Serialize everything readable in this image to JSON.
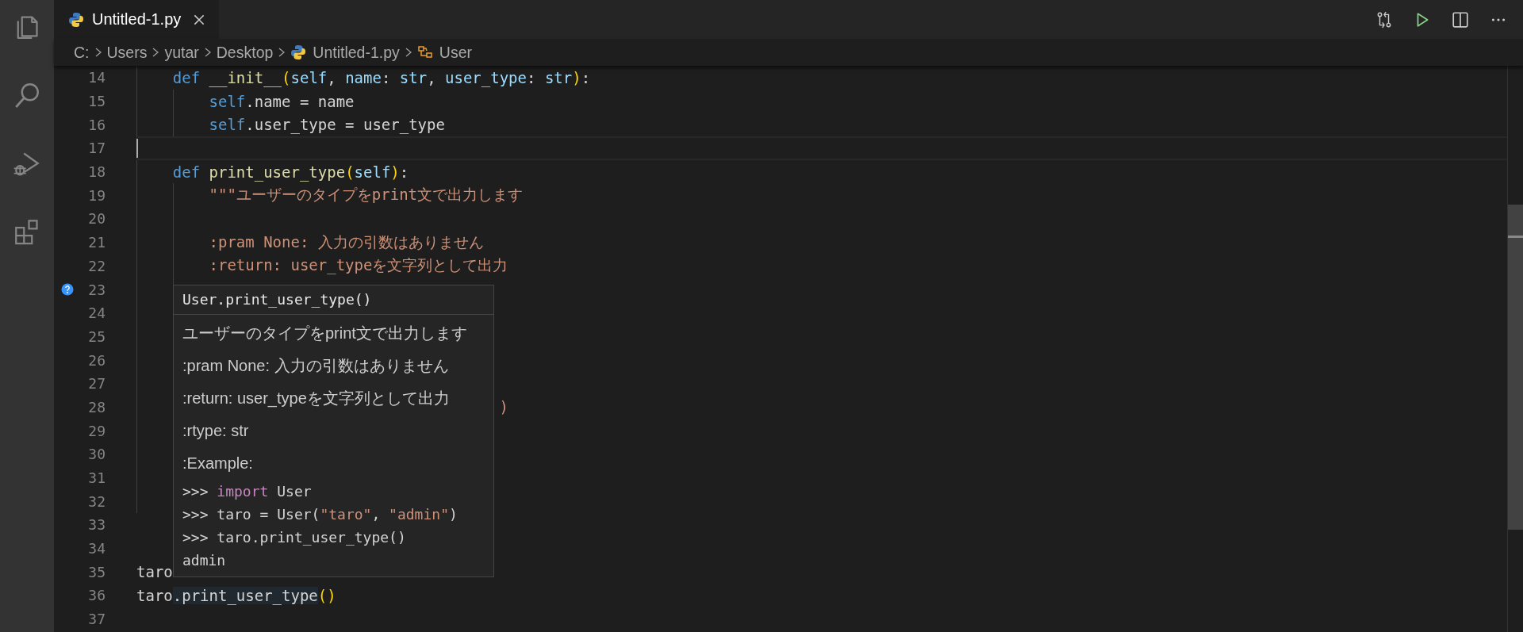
{
  "tab": {
    "label": "Untitled-1.py",
    "selected": true
  },
  "breadcrumbs": [
    {
      "kind": "folder",
      "label": "C:"
    },
    {
      "kind": "folder",
      "label": "Users"
    },
    {
      "kind": "folder",
      "label": "yutar"
    },
    {
      "kind": "folder",
      "label": "Desktop"
    },
    {
      "kind": "file",
      "label": "Untitled-1.py"
    },
    {
      "kind": "class",
      "label": "User"
    }
  ],
  "lines": [
    {
      "number": "14",
      "tokens": [
        {
          "kind": "kw",
          "t": "    def"
        },
        {
          "kind": "fn",
          "t": " __init__"
        },
        {
          "kind": "bracket",
          "t": "("
        },
        {
          "kind": "param",
          "t": "self"
        },
        {
          "kind": "plain",
          "t": ", "
        },
        {
          "kind": "param",
          "t": "name"
        },
        {
          "kind": "plain",
          "t": ": "
        },
        {
          "kind": "type",
          "t": "str"
        },
        {
          "kind": "plain",
          "t": ", "
        },
        {
          "kind": "param",
          "t": "user_type"
        },
        {
          "kind": "plain",
          "t": ": "
        },
        {
          "kind": "type",
          "t": "str"
        },
        {
          "kind": "bracket",
          "t": ")"
        },
        {
          "kind": "plain",
          "t": ":"
        }
      ]
    },
    {
      "number": "15",
      "tokens": [
        {
          "kind": "kw",
          "t": "        self"
        },
        {
          "kind": "plain",
          "t": ".name = name"
        }
      ]
    },
    {
      "number": "16",
      "tokens": [
        {
          "kind": "kw",
          "t": "        self"
        },
        {
          "kind": "plain",
          "t": ".user_type = user_type"
        }
      ]
    },
    {
      "number": "17",
      "current": true
    },
    {
      "number": "18",
      "tokens": [
        {
          "kind": "kw",
          "t": "    def"
        },
        {
          "kind": "fn",
          "t": " print_user_type"
        },
        {
          "kind": "bracket",
          "t": "("
        },
        {
          "kind": "param",
          "t": "self"
        },
        {
          "kind": "bracket",
          "t": ")"
        },
        {
          "kind": "plain",
          "t": ":"
        }
      ]
    },
    {
      "number": "19",
      "tokens": [
        {
          "kind": "str",
          "t": "        \"\"\"ユーザーのタイプをprint文で出力します"
        }
      ]
    },
    {
      "number": "20"
    },
    {
      "number": "21",
      "tokens": [
        {
          "kind": "str",
          "t": "        :pram None: 入力の引数はありません"
        }
      ]
    },
    {
      "number": "22",
      "tokens": [
        {
          "kind": "str",
          "t": "        :return: user_typeを文字列として出力"
        }
      ]
    },
    {
      "number": "23",
      "kind": "help"
    },
    {
      "number": "24"
    },
    {
      "number": "25"
    },
    {
      "number": "26"
    },
    {
      "number": "27"
    },
    {
      "number": "28",
      "tokens": [
        {
          "kind": "str",
          "t": "                                        )"
        }
      ]
    },
    {
      "number": "29",
      "covered": true
    },
    {
      "number": "30",
      "covered": true
    },
    {
      "number": "31",
      "covered": true
    },
    {
      "number": "32",
      "covered": true
    },
    {
      "number": "33"
    },
    {
      "number": "34"
    },
    {
      "number": "35",
      "tokens": [
        {
          "kind": "plain",
          "t": "taro"
        }
      ]
    },
    {
      "number": "36",
      "tokens": [
        {
          "kind": "plain",
          "t": "taro"
        },
        {
          "kind": "plain",
          "t": ".print_user_type",
          "highlighted": true
        },
        {
          "kind": "bracket",
          "t": "()"
        }
      ]
    },
    {
      "number": "37"
    }
  ],
  "hover": {
    "signature": "User.print_user_type()",
    "doc": [
      "ユーザーのタイプをprint文で出力します",
      ":pram None: 入力の引数はありません",
      ":return: user_typeを文字列として出力",
      ":rtype: str",
      ":Example:"
    ],
    "example": [
      [
        {
          "kind": "plain",
          "t": ">>> "
        },
        {
          "kind": "kw2",
          "t": "import"
        },
        {
          "kind": "plain",
          "t": " User"
        }
      ],
      [
        {
          "kind": "plain",
          "t": ">>> taro = User("
        },
        {
          "kind": "str",
          "t": "\"taro\""
        },
        {
          "kind": "plain",
          "t": ", "
        },
        {
          "kind": "str",
          "t": "\"admin\""
        },
        {
          "kind": "plain",
          "t": ")"
        }
      ],
      [
        {
          "kind": "plain",
          "t": ">>> taro.print_user_type()"
        }
      ],
      [
        {
          "kind": "plain",
          "t": "admin"
        }
      ]
    ]
  }
}
